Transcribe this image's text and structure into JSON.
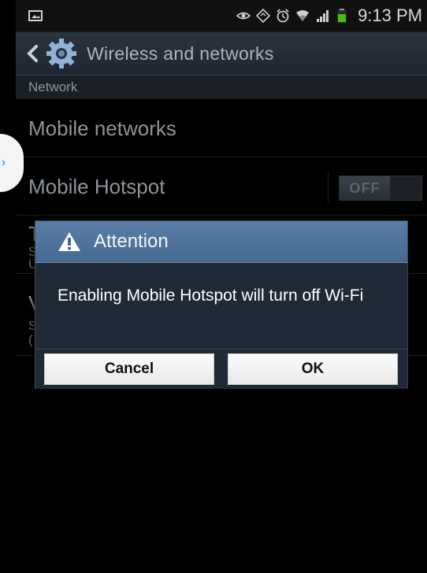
{
  "status_bar": {
    "time": "9:13 PM"
  },
  "action_bar": {
    "title": "Wireless and networks"
  },
  "list": {
    "section_header": "Network",
    "items": [
      {
        "title": "Mobile networks"
      },
      {
        "title": "Mobile Hotspot",
        "toggle": "OFF"
      }
    ],
    "partial_items": [
      {
        "big": "T",
        "small": [
          "S",
          "U"
        ]
      },
      {
        "big": "V",
        "small": [
          "S",
          "("
        ]
      }
    ]
  },
  "dialog": {
    "title": "Attention",
    "message": "Enabling Mobile Hotspot will turn off Wi-Fi",
    "cancel_label": "Cancel",
    "ok_label": "OK"
  },
  "icons": {
    "status_left": "screenshot-icon",
    "status_right": [
      "eye-icon",
      "nfc-icon",
      "alarm-icon",
      "wifi-icon",
      "signal-icon",
      "battery-icon"
    ],
    "header": [
      "back-chevron-icon",
      "settings-gear-icon"
    ],
    "dialog": "warning-icon"
  },
  "colors": {
    "dialog_header": "#5279a1",
    "battery": "#4cbb17",
    "edge_handle_chevron": "#3aa8d8"
  }
}
